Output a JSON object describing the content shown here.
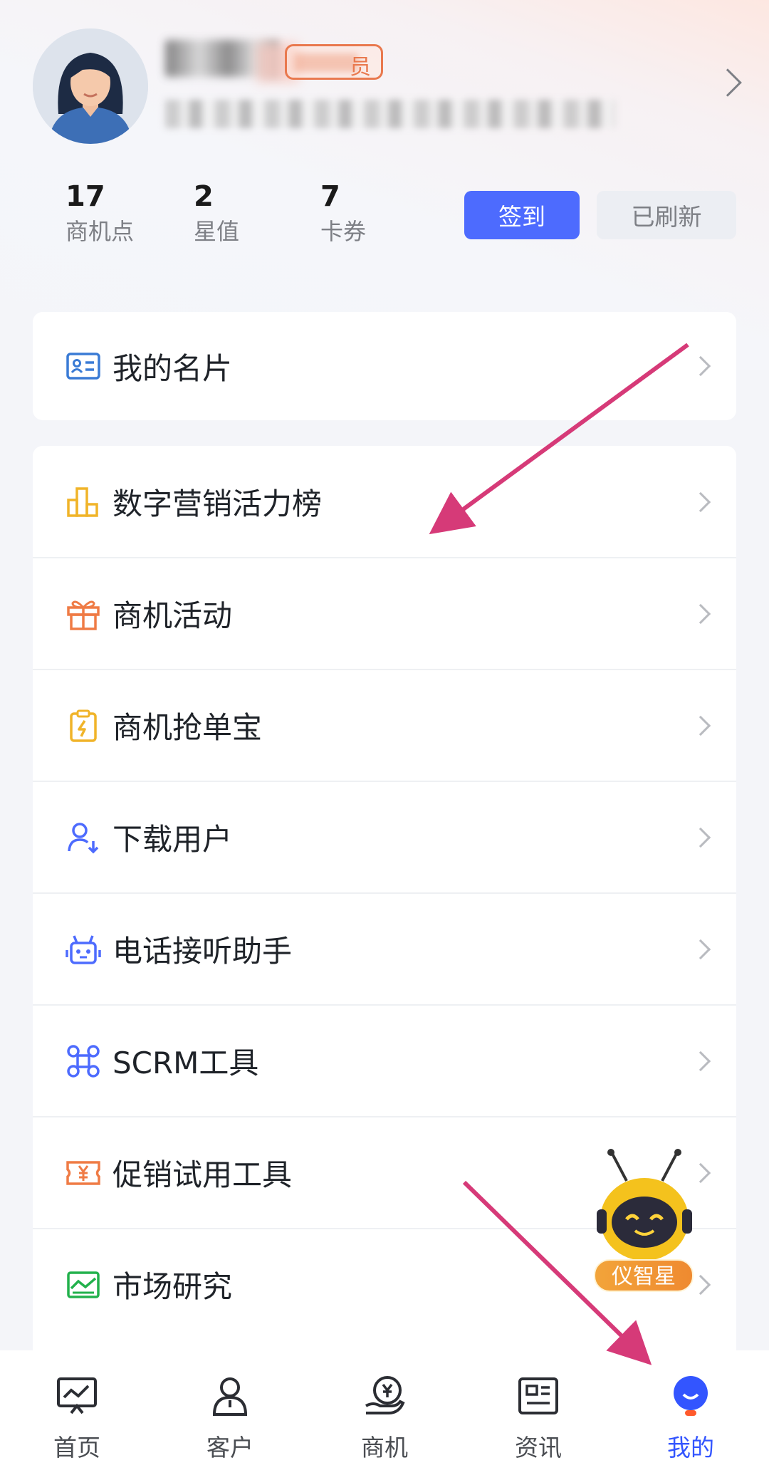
{
  "colors": {
    "accent": "#4d6bfe",
    "active_tab": "#3355ff",
    "member_badge": "#e9794e",
    "annotation_arrow": "#d63a78"
  },
  "profile": {
    "name": "",
    "badge_tail": "员",
    "subtitle": ""
  },
  "stats": [
    {
      "value": "17",
      "label": "商机点"
    },
    {
      "value": "2",
      "label": "星值"
    },
    {
      "value": "7",
      "label": "卡券"
    }
  ],
  "actions": {
    "signin": "签到",
    "refresh": "已刷新"
  },
  "card_menu": {
    "label": "我的名片",
    "icon": "business-card-icon"
  },
  "menu": [
    {
      "label": "数字营销活力榜",
      "icon": "bar-chart-icon",
      "color": "#f0b429"
    },
    {
      "label": "商机活动",
      "icon": "gift-icon",
      "color": "#ef7b45"
    },
    {
      "label": "商机抢单宝",
      "icon": "clipboard-flash-icon",
      "color": "#f0b429"
    },
    {
      "label": "下载用户",
      "icon": "user-download-icon",
      "color": "#4d6bfe"
    },
    {
      "label": "电话接听助手",
      "icon": "robot-icon",
      "color": "#4d6bfe"
    },
    {
      "label": "SCRM工具",
      "icon": "command-icon",
      "color": "#4d6bfe"
    },
    {
      "label": "促销试用工具",
      "icon": "coupon-icon",
      "color": "#ef7b45"
    },
    {
      "label": "市场研究",
      "icon": "chart-picture-icon",
      "color": "#22b14c"
    }
  ],
  "assistant": {
    "label": "仪智星"
  },
  "tabs": [
    {
      "label": "首页",
      "icon": "home-chart-icon"
    },
    {
      "label": "客户",
      "icon": "customer-icon"
    },
    {
      "label": "商机",
      "icon": "opportunity-icon"
    },
    {
      "label": "资讯",
      "icon": "news-icon"
    },
    {
      "label": "我的",
      "icon": "mine-icon"
    }
  ]
}
